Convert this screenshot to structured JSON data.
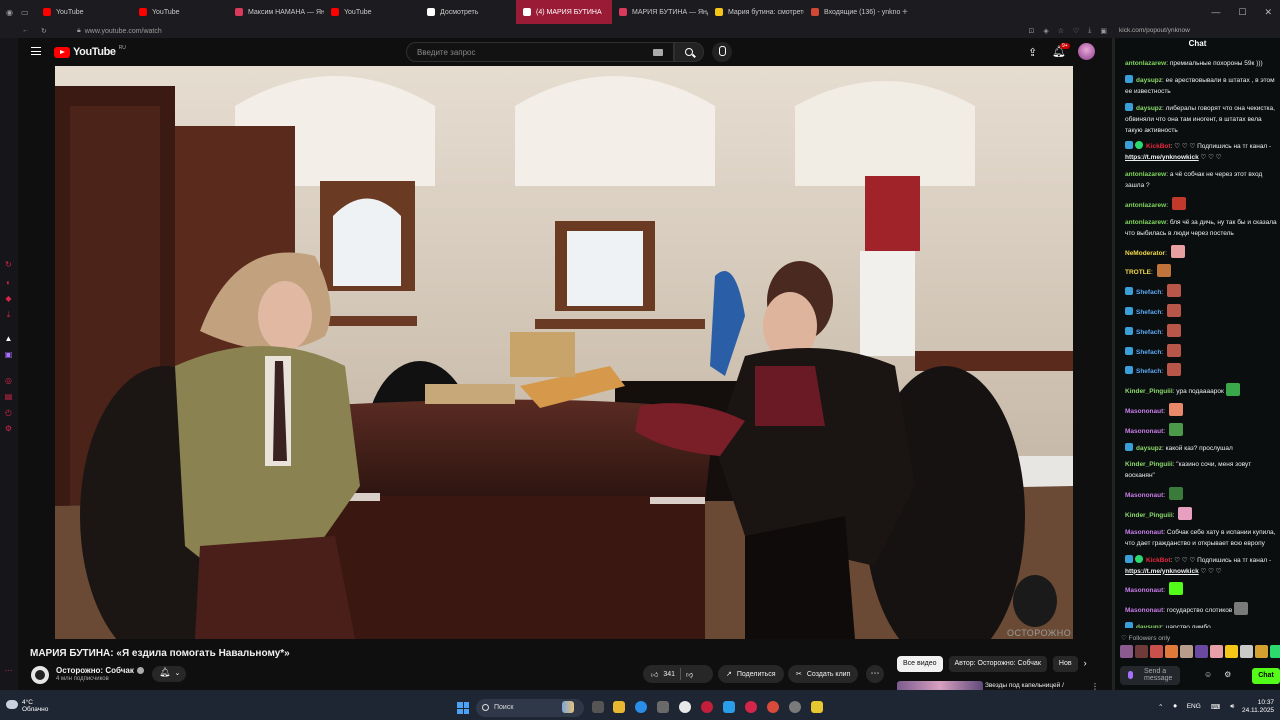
{
  "browser": {
    "tabs": [
      {
        "label": "YouTube",
        "color": "#ff0000"
      },
      {
        "label": "YouTube",
        "color": "#ff0000"
      },
      {
        "label": "Максим НАМАНА — Янд",
        "color": "#d93a5c"
      },
      {
        "label": "YouTube",
        "color": "#ff0000"
      },
      {
        "label": "Досмотреть",
        "color": "#ffffff"
      },
      {
        "label": "(4) МАРИЯ БУТИНА",
        "color": "#ffffff",
        "active": true
      },
      {
        "label": "МАРИЯ БУТИНА — Янд",
        "color": "#d93a5c"
      },
      {
        "label": "Мария бутина: смотрете",
        "color": "#f5c518"
      },
      {
        "label": "Входящие (136) - ynkno",
        "color": "#d14836"
      }
    ],
    "url": "www.youtube.com/watch",
    "chat_url": "kick.com/popout/ynknow"
  },
  "youtube": {
    "logo_text": "YouTube",
    "logo_suffix": "RU",
    "search_placeholder": "Введите запрос",
    "notif_count": "9+",
    "video_title": "МАРИЯ БУТИНА: «Я ездила помогать Навальному*»",
    "channel": {
      "name": "Осторожно: Собчак",
      "subs": "4 млн подписчиков"
    },
    "likes": "341",
    "share_label": "Поделиться",
    "clip_label": "Создать клип",
    "chips": [
      "Все видео",
      "Автор: Осторожно: Собчак",
      "Нов"
    ],
    "rec_title": "Звезды под капельницей /",
    "watermark": "ОСТОРОЖНО"
  },
  "chat": {
    "header": "Chat",
    "messages": [
      {
        "user": "antonlazarew",
        "color": "#7fd65c",
        "text": "премиальные похороны 59к )))"
      },
      {
        "user": "daysupz",
        "color": "#8cd96b",
        "badge": "blue",
        "text": "ее арествовывали в штатах , в этом ее известность"
      },
      {
        "user": "daysupz",
        "color": "#8cd96b",
        "badge": "blue",
        "text": "либералы говорят что она чекистка, обвиняли что она там иногент, в штатах вела такую активность"
      },
      {
        "user": "KickBot",
        "color": "#e8283c",
        "badge": "bot",
        "text": "♡ ♡ ♡ Подпишись на тг канал - ",
        "link": "https://t.me/ynknowkick",
        "tail": " ♡ ♡ ♡"
      },
      {
        "user": "antonlazarew",
        "color": "#7fd65c",
        "text": "а чё собчак не через этот вход зашла ?"
      },
      {
        "user": "antonlazarew",
        "color": "#7fd65c",
        "emote": "#c0392b"
      },
      {
        "user": "antonlazarew",
        "color": "#7fd65c",
        "text": "бля чё за дичь, ну так бы и сказала что выбилась в люди через постель"
      },
      {
        "user": "NeModerator",
        "color": "#f3d84a",
        "emote": "#e8a0a0"
      },
      {
        "user": "TROTLE",
        "color": "#f3d84a",
        "emote": "#c0743c"
      },
      {
        "user": "Shefach",
        "color": "#5aa8f5",
        "badge": "blue",
        "emote": "#b8564a"
      },
      {
        "user": "Shefach",
        "color": "#5aa8f5",
        "badge": "blue",
        "emote": "#b8564a"
      },
      {
        "user": "Shefach",
        "color": "#5aa8f5",
        "badge": "blue",
        "emote": "#b8564a"
      },
      {
        "user": "Shefach",
        "color": "#5aa8f5",
        "badge": "blue",
        "emote": "#b8564a"
      },
      {
        "user": "Shefach",
        "color": "#5aa8f5",
        "badge": "blue",
        "emote": "#b8564a"
      },
      {
        "user": "Kinder_Pinguiii",
        "color": "#8cd96b",
        "text": "ура подаааарок",
        "emote": "#3aa84a"
      },
      {
        "user": "Masononaut",
        "color": "#c77ce8",
        "emote": "#e88a6a"
      },
      {
        "user": "Masononaut",
        "color": "#c77ce8",
        "emote": "#4a9a4a"
      },
      {
        "user": "daysupz",
        "color": "#8cd96b",
        "badge": "blue",
        "text": "какой каз? прослушал"
      },
      {
        "user": "Kinder_Pinguiii",
        "color": "#8cd96b",
        "text": "\"казино сочи, меня зовут восканян\""
      },
      {
        "user": "Masononaut",
        "color": "#c77ce8",
        "emote": "#3a7a3a"
      },
      {
        "user": "Kinder_Pinguiii",
        "color": "#8cd96b",
        "emote": "#e8a0c0"
      },
      {
        "user": "Masononaut",
        "color": "#c77ce8",
        "text": "Собчак себе хату в испании купила, что дает гражданство и открывает всю европу"
      },
      {
        "user": "KickBot",
        "color": "#e8283c",
        "badge": "bot",
        "text": "♡ ♡ ♡ Подпишись на тг канал - ",
        "link": "https://t.me/ynknowkick",
        "tail": " ♡ ♡ ♡"
      },
      {
        "user": "Masononaut",
        "color": "#c77ce8",
        "emote": "#53fc18"
      },
      {
        "user": "Masononaut",
        "color": "#c77ce8",
        "text": "государство слотиков",
        "emote": "#7a7a7a"
      },
      {
        "user": "daysupz",
        "color": "#8cd96b",
        "badge": "blue",
        "text": "царство лимбо"
      }
    ],
    "followers_only": "Followers only",
    "input_placeholder": "Send a message",
    "send_label": "Chat",
    "emote_row_colors": [
      "#8b5a8e",
      "#6e3a3a",
      "#c9514b",
      "#e07a3b",
      "#b89c8c",
      "#6a4aa0",
      "#e8a0a8",
      "#f5c518",
      "#c9c9c9",
      "#d4a030",
      "#2bd96f",
      "#3aa84a",
      "#5a5a5a"
    ]
  },
  "taskbar": {
    "temp": "4°C",
    "weather": "Облачно",
    "search": "Поиск",
    "lang": "ENG",
    "time": "10:37",
    "date": "24.11.2025"
  }
}
